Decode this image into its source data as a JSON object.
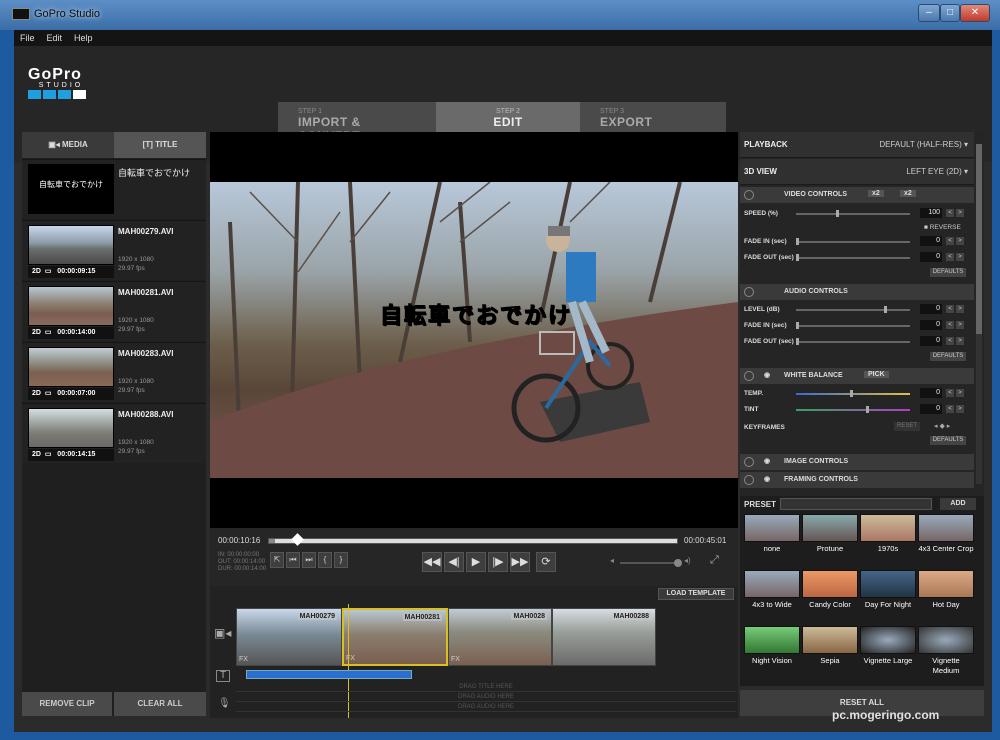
{
  "window": {
    "title": "GoPro Studio"
  },
  "menu": [
    "File",
    "Edit",
    "Help"
  ],
  "logo": {
    "text": "GoPro",
    "sub": "STUDIO"
  },
  "steps": [
    {
      "num": "STEP 1",
      "label": "IMPORT & CONVERT"
    },
    {
      "num": "STEP 2",
      "label": "EDIT"
    },
    {
      "num": "STEP 3",
      "label": "EXPORT"
    }
  ],
  "left": {
    "tab_media": "MEDIA",
    "tab_title": "TITLE",
    "title_clip": {
      "thumb_text": "自転車でおでかけ",
      "name": "自転車でおでかけ"
    },
    "clips": [
      {
        "name": "MAH00279.AVI",
        "res": "1920 x 1080",
        "fps": "29.97 fps",
        "mode": "2D",
        "dur": "00:00:09:15"
      },
      {
        "name": "MAH00281.AVI",
        "res": "1920 x 1080",
        "fps": "29.97 fps",
        "mode": "2D",
        "dur": "00:00:14:00"
      },
      {
        "name": "MAH00283.AVI",
        "res": "1920 x 1080",
        "fps": "29.97 fps",
        "mode": "2D",
        "dur": "00:00:07:00"
      },
      {
        "name": "MAH00288.AVI",
        "res": "1920 x 1080",
        "fps": "29.97 fps",
        "mode": "2D",
        "dur": "00:00:14:15"
      }
    ],
    "remove_clip": "REMOVE CLIP",
    "clear_all": "CLEAR ALL"
  },
  "viewer": {
    "subtitle": "自転車でおでかけ"
  },
  "transport": {
    "tc_current": "00:00:10:16",
    "tc_end": "00:00:45:01",
    "in": "IN: 00:00:00:00",
    "out": "OUT: 00:00:14:00",
    "dur": "DUR: 00:00:14:00",
    "playhead_fraction": 0.07
  },
  "timeline": {
    "load_template": "LOAD TEMPLATE",
    "clip_labels": [
      "MAH00279",
      "MAH00281",
      "MAH0028",
      "MAH00288"
    ],
    "fx": "FX",
    "drag_title": "DRAG TITLE HERE",
    "drag_audio1": "DRAG AUDIO HERE",
    "drag_audio2": "DRAG AUDIO HERE"
  },
  "right": {
    "playback_label": "PLAYBACK",
    "playback_value": "DEFAULT (HALF-RES)",
    "view_label": "3D VIEW",
    "view_value": "LEFT EYE (2D)",
    "video_controls": "VIDEO CONTROLS",
    "x2a": "x2",
    "x2b": "x2",
    "speed": "SPEED (%)",
    "speed_val": "100",
    "reverse": "REVERSE",
    "fade_in": "FADE IN (sec)",
    "fade_out": "FADE OUT (sec)",
    "zero": "0",
    "defaults": "DEFAULTS",
    "audio_controls": "AUDIO CONTROLS",
    "level": "LEVEL (dB)",
    "white_balance": "WHITE BALANCE",
    "pick": "PICK",
    "temp": "TEMP.",
    "tint": "TINT",
    "keyframes": "KEYFRAMES",
    "reset": "RESET",
    "image_controls": "IMAGE CONTROLS",
    "framing_controls": "FRAMING CONTROLS"
  },
  "presets": {
    "label": "PRESET",
    "add": "ADD",
    "items": [
      "none",
      "Protune",
      "1970s",
      "4x3 Center Crop",
      "4x3 to Wide",
      "Candy Color",
      "Day For Night",
      "Hot Day",
      "Night Vision",
      "Sepia",
      "Vignette Large",
      "Vignette Medium"
    ],
    "reset_all": "RESET ALL"
  },
  "watermark": "pc.mogeringo.com"
}
